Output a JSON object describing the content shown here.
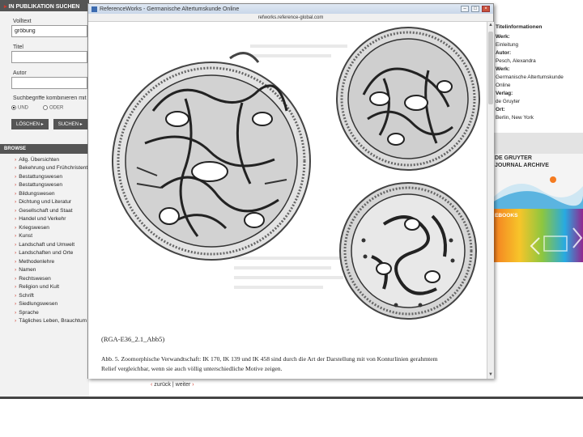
{
  "sidebar": {
    "header": "IN PUBLIKATION SUCHEN",
    "volltext_label": "Volltext",
    "volltext_value": "gröbung",
    "titel_label": "Titel",
    "autor_label": "Autor",
    "combine_label": "Suchbegriffe kombinieren mit",
    "radio_und": "UND",
    "radio_oder": "ODER",
    "btn_loeschen": "LÖSCHEN",
    "btn_suchen": "SUCHEN",
    "browse_header": "BROWSE",
    "browse_items": [
      "Allg. Übersichten",
      "Bekehrung und Frühchristentum",
      "Bestattungswesen",
      "Bestattungswesen",
      "Bildungswesen",
      "Dichtung und Literatur",
      "Gesellschaft und Staat",
      "Handel und Verkehr",
      "Kriegswesen",
      "Kunst",
      "Landschaft und Umwelt",
      "Landschaften und Orte",
      "Methodenlehre",
      "Namen",
      "Rechtswesen",
      "Religion und Kult",
      "Schrift",
      "Siedlungswesen",
      "Sprache",
      "Tägliches Leben, Brauchtum"
    ]
  },
  "popup": {
    "title": "ReferenceWorks - Germanische Altertumskunde Online",
    "url": "refworks.reference-global.com",
    "caption_id": "(RGA-E36_2.1_Abb5)",
    "caption_text": "Abb. 5. Zoomorphische Verwandtschaft: IK 170, IK 139 und IK 458 sind durch die Art der Darstellung mit von Konturlinien gerahmtem Relief vergleichbar, wenn sie auch völlig unterschiedliche Motive zeigen."
  },
  "pager": {
    "back": "zurück",
    "sep": "|",
    "next": "weiter"
  },
  "rightpanel": {
    "title": "Titelinformationen",
    "rows": [
      "Werk:",
      "Einleitung",
      "Autor:",
      "Pesch, Alexandra",
      "Werk:",
      "Germanische Altertumskunde",
      "Online",
      "Verlag:",
      "de Gruyter",
      "Ort:",
      "Berlin, New York"
    ],
    "ad_journal_line1": "DE GRUYTER",
    "ad_journal_line2": "JOURNAL ARCHIVE",
    "ad_ebooks": "EBOOKS"
  },
  "colors": {
    "accent_red": "#d03a2c",
    "header_gray": "#555555"
  }
}
